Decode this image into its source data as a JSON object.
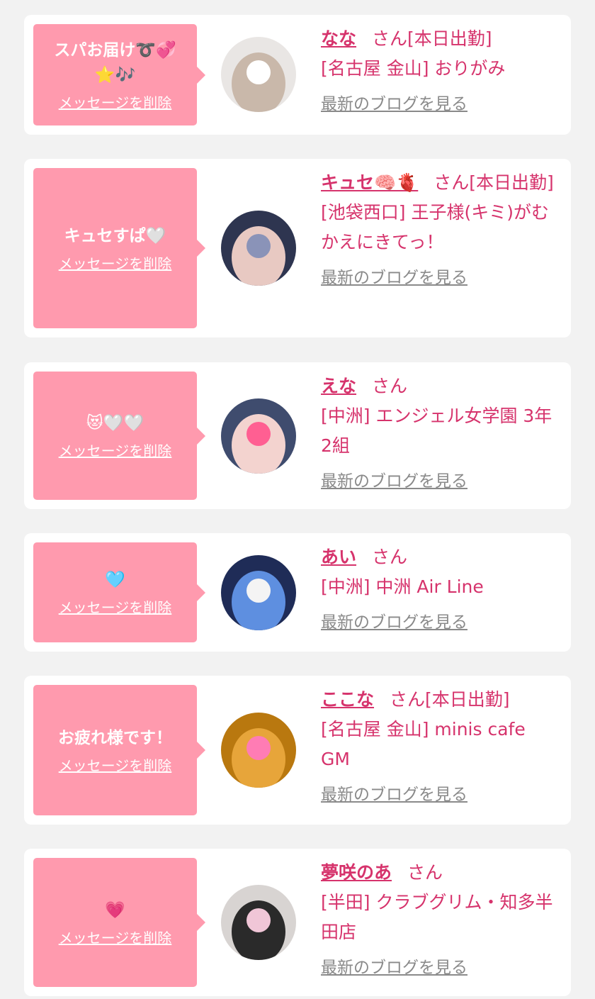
{
  "cards": [
    {
      "message": "スパお届け➰💞⭐️🎶",
      "delete_label": "メッセージを削除",
      "name": "なな",
      "honorific": "さん",
      "status": "[本日出勤]",
      "shop": "[名古屋 金山] おりがみ",
      "blog_link": "最新のブログを見る",
      "avatar_icon": "girl-photo-avatar",
      "avatar_colors": [
        "#e9e6e4",
        "#c9b8aa",
        "#ffffff"
      ]
    },
    {
      "message": "キュセすぱ🤍",
      "delete_label": "メッセージを削除",
      "name": "キュセ🧠🫀",
      "honorific": "さん",
      "status": "[本日出勤]",
      "shop": "[池袋西口] 王子様(キミ)がむかえにきてっ！",
      "blog_link": "最新のブログを見る",
      "avatar_icon": "girl-photo-avatar",
      "avatar_colors": [
        "#2e3550",
        "#e8c9c2",
        "#8a93b8"
      ]
    },
    {
      "message": "😻🤍🤍",
      "delete_label": "メッセージを削除",
      "name": "えな",
      "honorific": "さん",
      "status": "",
      "shop": "[中洲] エンジェル女学園 3年2組",
      "blog_link": "最新のブログを見る",
      "avatar_icon": "girl-photo-avatar",
      "avatar_colors": [
        "#3f4c6e",
        "#f3d3cf",
        "#ff5f92"
      ]
    },
    {
      "message": "🩵",
      "delete_label": "メッセージを削除",
      "name": "あい",
      "honorific": "さん",
      "status": "",
      "shop": "[中洲] 中洲 Air Line",
      "blog_link": "最新のブログを見る",
      "avatar_icon": "girl-photo-avatar",
      "avatar_colors": [
        "#1f2c57",
        "#5e8fe0",
        "#f4f4f4"
      ]
    },
    {
      "message": "お疲れ様です！",
      "delete_label": "メッセージを削除",
      "name": "ここな",
      "honorific": "さん",
      "status": "[本日出勤]",
      "shop": "[名古屋 金山] minis cafe GM",
      "blog_link": "最新のブログを見る",
      "avatar_icon": "girl-photo-avatar",
      "avatar_colors": [
        "#b9780f",
        "#e7a53a",
        "#ff7cb4"
      ]
    },
    {
      "message": "💗",
      "delete_label": "メッセージを削除",
      "name": "夢咲のあ",
      "honorific": "さん",
      "status": "",
      "shop": "[半田] クラブグリム・知多半田店",
      "blog_link": "最新のブログを見る",
      "avatar_icon": "girl-photo-avatar",
      "avatar_colors": [
        "#d8d4d2",
        "#2a2a2a",
        "#f0c6d7"
      ]
    }
  ]
}
